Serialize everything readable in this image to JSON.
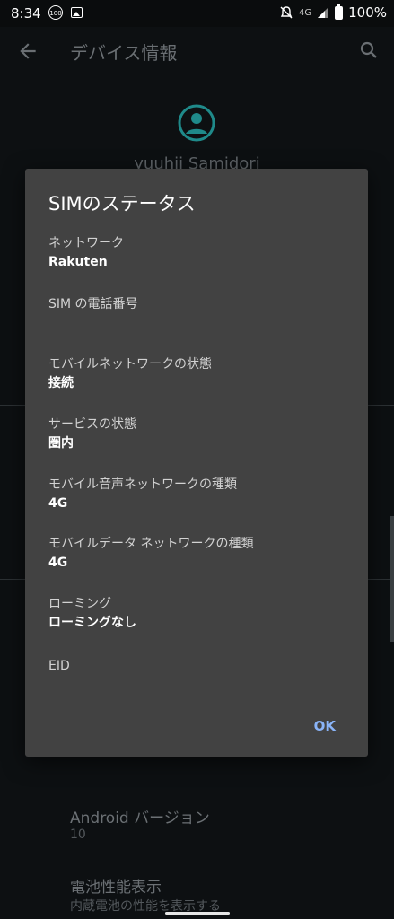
{
  "status_bar": {
    "time": "8:34",
    "notification_badge": "100",
    "network": "4G",
    "battery": "100%"
  },
  "app_bar": {
    "title": "デバイス情報"
  },
  "background": {
    "device_name": "yuuhii Samidori",
    "items": [
      {
        "title": "Android バージョン",
        "subtitle": "10"
      },
      {
        "title": "電池性能表示",
        "subtitle": "内蔵電池の性能を表示する"
      }
    ]
  },
  "dialog": {
    "title": "SIMのステータス",
    "fields": [
      {
        "label": "ネットワーク",
        "value": "Rakuten"
      },
      {
        "label": "SIM の電話番号",
        "value": ""
      },
      {
        "label": "モバイルネットワークの状態",
        "value": "接続"
      },
      {
        "label": "サービスの状態",
        "value": "圏内"
      },
      {
        "label": "モバイル音声ネットワークの種類",
        "value": "4G"
      },
      {
        "label": "モバイルデータ ネットワークの種類",
        "value": "4G"
      },
      {
        "label": "ローミング",
        "value": "ローミングなし"
      },
      {
        "label": "EID",
        "value": ""
      }
    ],
    "ok_label": "OK"
  },
  "colors": {
    "dialog_bg": "#424242",
    "accent": "#8ab4f8",
    "avatar": "#1f8a8a"
  }
}
